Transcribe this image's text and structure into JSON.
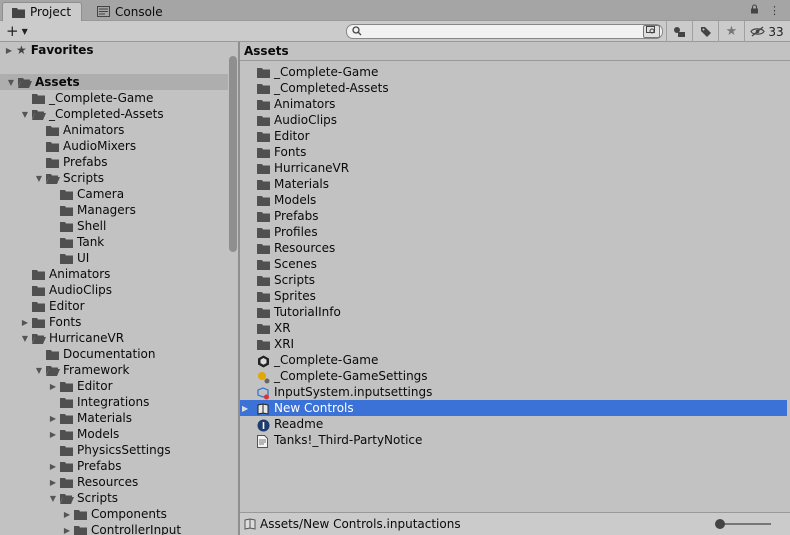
{
  "tabs": [
    {
      "label": "Project",
      "icon": "folder-icon",
      "active": true
    },
    {
      "label": "Console",
      "icon": "console-icon",
      "active": false
    }
  ],
  "toolbar": {
    "create_label": "+",
    "search_placeholder": "",
    "hidden_count": "33"
  },
  "tree": {
    "favorites_label": "Favorites",
    "items": [
      {
        "label": "Assets",
        "depth": 0,
        "expand": "open",
        "bold": true
      },
      {
        "label": "_Complete-Game",
        "depth": 1,
        "expand": "none"
      },
      {
        "label": "_Completed-Assets",
        "depth": 1,
        "expand": "open"
      },
      {
        "label": "Animators",
        "depth": 2,
        "expand": "none"
      },
      {
        "label": "AudioMixers",
        "depth": 2,
        "expand": "none"
      },
      {
        "label": "Prefabs",
        "depth": 2,
        "expand": "none"
      },
      {
        "label": "Scripts",
        "depth": 2,
        "expand": "open"
      },
      {
        "label": "Camera",
        "depth": 3,
        "expand": "none"
      },
      {
        "label": "Managers",
        "depth": 3,
        "expand": "none"
      },
      {
        "label": "Shell",
        "depth": 3,
        "expand": "none"
      },
      {
        "label": "Tank",
        "depth": 3,
        "expand": "none"
      },
      {
        "label": "UI",
        "depth": 3,
        "expand": "none"
      },
      {
        "label": "Animators",
        "depth": 1,
        "expand": "none"
      },
      {
        "label": "AudioClips",
        "depth": 1,
        "expand": "none"
      },
      {
        "label": "Editor",
        "depth": 1,
        "expand": "none"
      },
      {
        "label": "Fonts",
        "depth": 1,
        "expand": "closed"
      },
      {
        "label": "HurricaneVR",
        "depth": 1,
        "expand": "open"
      },
      {
        "label": "Documentation",
        "depth": 2,
        "expand": "none"
      },
      {
        "label": "Framework",
        "depth": 2,
        "expand": "open"
      },
      {
        "label": "Editor",
        "depth": 3,
        "expand": "closed"
      },
      {
        "label": "Integrations",
        "depth": 3,
        "expand": "none"
      },
      {
        "label": "Materials",
        "depth": 3,
        "expand": "closed"
      },
      {
        "label": "Models",
        "depth": 3,
        "expand": "closed"
      },
      {
        "label": "PhysicsSettings",
        "depth": 3,
        "expand": "none"
      },
      {
        "label": "Prefabs",
        "depth": 3,
        "expand": "closed"
      },
      {
        "label": "Resources",
        "depth": 3,
        "expand": "closed"
      },
      {
        "label": "Scripts",
        "depth": 3,
        "expand": "open"
      },
      {
        "label": "Components",
        "depth": 4,
        "expand": "closed"
      },
      {
        "label": "ControllerInput",
        "depth": 4,
        "expand": "closed"
      }
    ]
  },
  "assets_panel": {
    "header": "Assets",
    "items": [
      {
        "label": "_Complete-Game",
        "icon": "folder-icon"
      },
      {
        "label": "_Completed-Assets",
        "icon": "folder-icon"
      },
      {
        "label": "Animators",
        "icon": "folder-icon"
      },
      {
        "label": "AudioClips",
        "icon": "folder-icon"
      },
      {
        "label": "Editor",
        "icon": "folder-icon"
      },
      {
        "label": "Fonts",
        "icon": "folder-icon"
      },
      {
        "label": "HurricaneVR",
        "icon": "folder-icon"
      },
      {
        "label": "Materials",
        "icon": "folder-icon"
      },
      {
        "label": "Models",
        "icon": "folder-icon"
      },
      {
        "label": "Prefabs",
        "icon": "folder-icon"
      },
      {
        "label": "Profiles",
        "icon": "folder-icon"
      },
      {
        "label": "Resources",
        "icon": "folder-icon"
      },
      {
        "label": "Scenes",
        "icon": "folder-icon"
      },
      {
        "label": "Scripts",
        "icon": "folder-icon"
      },
      {
        "label": "Sprites",
        "icon": "folder-icon"
      },
      {
        "label": "TutorialInfo",
        "icon": "folder-icon"
      },
      {
        "label": "XR",
        "icon": "folder-icon"
      },
      {
        "label": "XRI",
        "icon": "folder-icon"
      },
      {
        "label": "_Complete-Game",
        "icon": "unity-scene-icon"
      },
      {
        "label": "_Complete-GameSettings",
        "icon": "lighting-settings-icon"
      },
      {
        "label": "InputSystem.inputsettings",
        "icon": "input-settings-icon"
      },
      {
        "label": "New Controls",
        "icon": "input-actions-icon",
        "selected": true
      },
      {
        "label": "Readme",
        "icon": "info-icon"
      },
      {
        "label": "Tanks!_Third-PartyNotice",
        "icon": "text-file-icon"
      }
    ]
  },
  "footer": {
    "path": "Assets/New Controls.inputactions",
    "zoom_level": 0.0
  },
  "colors": {
    "background": "#c2c2c2",
    "selection": "#3a72d8",
    "folder": "#505050"
  }
}
